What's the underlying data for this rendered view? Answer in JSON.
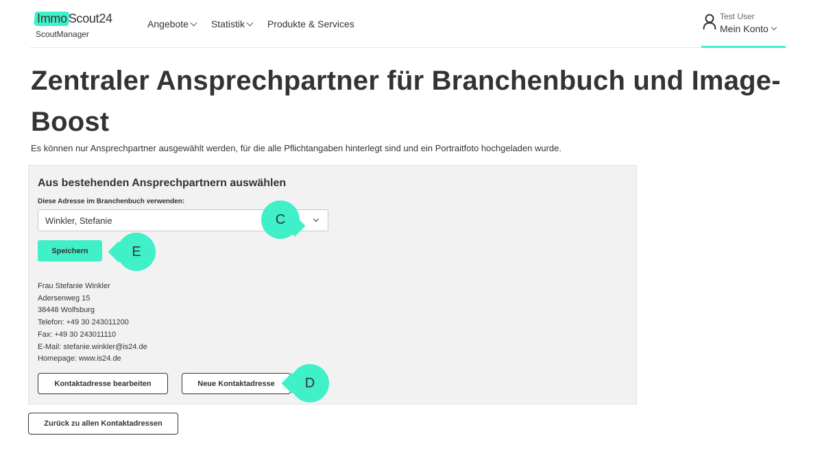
{
  "header": {
    "logo_highlight": "Immo",
    "logo_rest": "Scout24",
    "logo_sub": "ScoutManager",
    "nav": [
      {
        "label": "Angebote",
        "has_dropdown": true
      },
      {
        "label": "Statistik",
        "has_dropdown": true
      },
      {
        "label": "Produkte & Services",
        "has_dropdown": false
      }
    ],
    "account": {
      "user": "Test User",
      "label": "Mein Konto",
      "icon": "user-icon"
    }
  },
  "page": {
    "title": "Zentraler Ansprechpartner für Branchenbuch und Image-Boost",
    "intro": "Es können nur Ansprechpartner ausgewählt werden, für die alle Pflichtangaben hinterlegt sind und ein Portraitfoto hochgeladen wurde."
  },
  "panel": {
    "title": "Aus bestehenden Ansprechpartnern auswählen",
    "field_label": "Diese Adresse im Branchenbuch verwenden:",
    "selected_value": "Winkler, Stefanie",
    "save_label": "Speichern",
    "address_lines": [
      "Frau Stefanie Winkler",
      "Adersenweg 15",
      "38448 Wolfsburg",
      "Telefon: +49 30 243011200",
      "Fax: +49 30 243011110",
      "E-Mail: stefanie.winkler@is24.de",
      "Homepage: www.is24.de"
    ],
    "edit_label": "Kontaktadresse bearbeiten",
    "new_label": "Neue Kontaktadresse"
  },
  "back_label": "Zurück zu allen Kontaktadressen",
  "markers": {
    "c": "C",
    "d": "D",
    "e": "E"
  },
  "colors": {
    "accent": "#3ff0c9",
    "panel_bg": "#f2f2f2",
    "text": "#333333"
  }
}
